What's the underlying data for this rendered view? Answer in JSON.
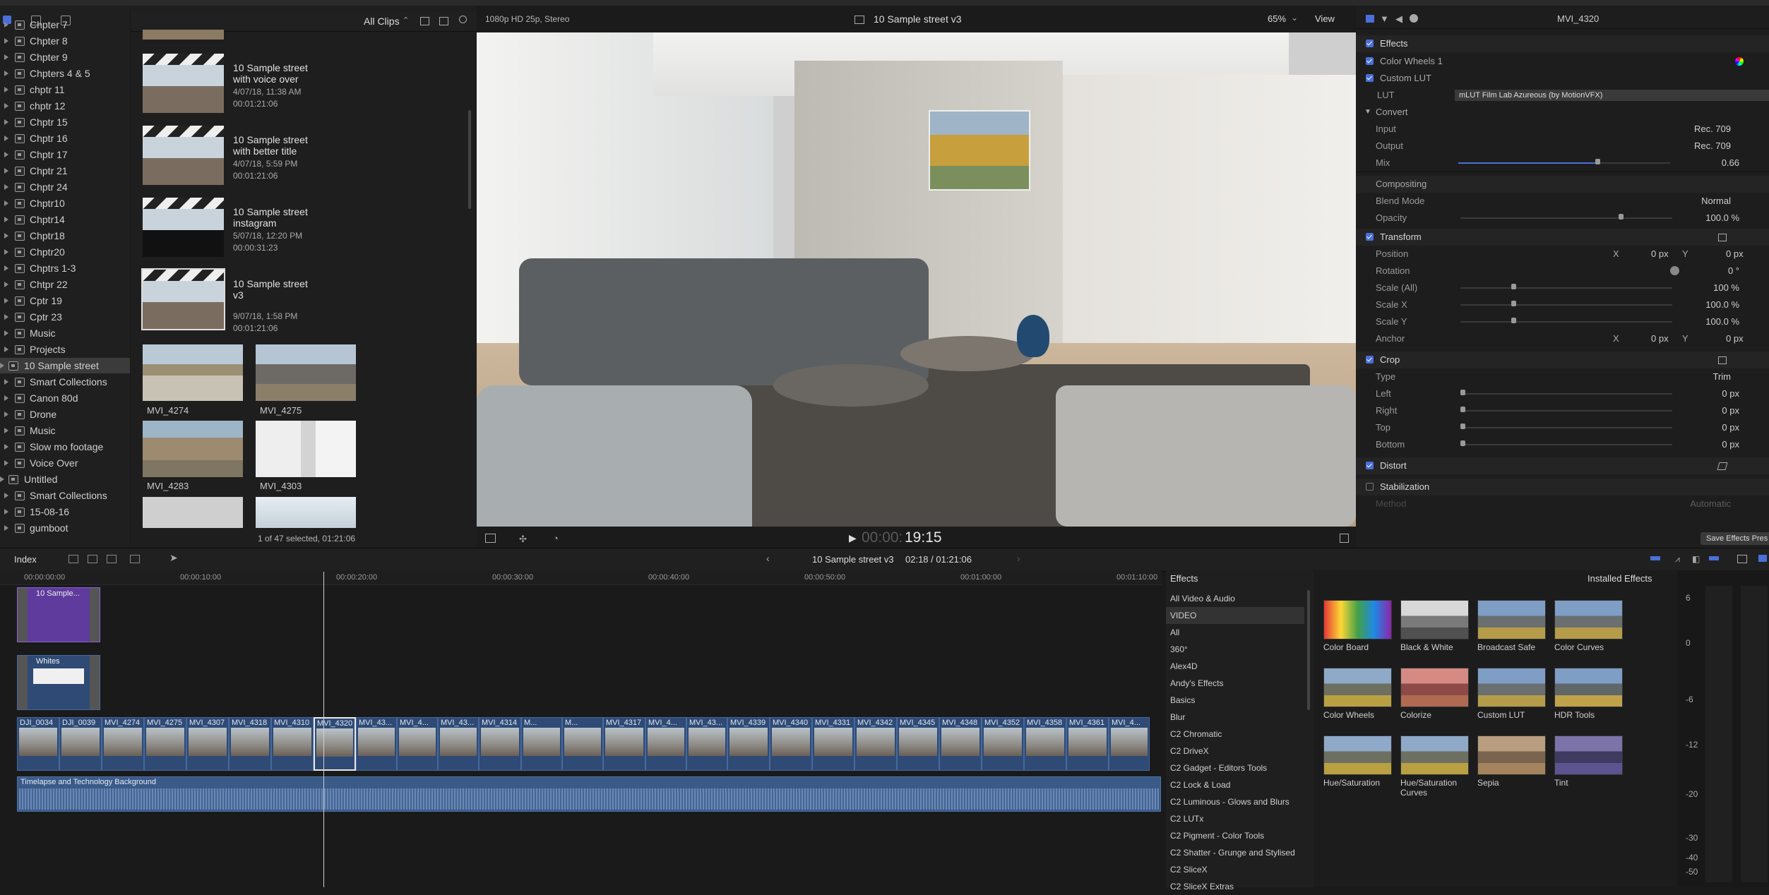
{
  "sidebar": {
    "items": [
      {
        "label": "Chpter 7",
        "lvl": 1
      },
      {
        "label": "Chpter 8",
        "lvl": 1
      },
      {
        "label": "Chpter 9",
        "lvl": 1
      },
      {
        "label": "Chpters 4 & 5",
        "lvl": 1
      },
      {
        "label": "chptr 11",
        "lvl": 1
      },
      {
        "label": "chptr 12",
        "lvl": 1
      },
      {
        "label": "Chptr 15",
        "lvl": 1
      },
      {
        "label": "Chptr 16",
        "lvl": 1
      },
      {
        "label": "Chptr 17",
        "lvl": 1
      },
      {
        "label": "Chptr 21",
        "lvl": 1
      },
      {
        "label": "Chptr 24",
        "lvl": 1
      },
      {
        "label": "Chptr10",
        "lvl": 1
      },
      {
        "label": "Chptr14",
        "lvl": 1
      },
      {
        "label": "Chptr18",
        "lvl": 1
      },
      {
        "label": "Chptr20",
        "lvl": 1
      },
      {
        "label": "Chptrs 1-3",
        "lvl": 1
      },
      {
        "label": "Chtpr 22",
        "lvl": 1
      },
      {
        "label": "Cptr 19",
        "lvl": 1
      },
      {
        "label": "Cptr 23",
        "lvl": 1
      },
      {
        "label": "Music",
        "lvl": 1
      },
      {
        "label": "Projects",
        "lvl": 1
      },
      {
        "label": "10 Sample street",
        "lvl": 0,
        "selected": true
      },
      {
        "label": "Smart Collections",
        "lvl": 1
      },
      {
        "label": "Canon 80d",
        "lvl": 1
      },
      {
        "label": "Drone",
        "lvl": 1
      },
      {
        "label": "Music",
        "lvl": 1
      },
      {
        "label": "Slow mo footage",
        "lvl": 1
      },
      {
        "label": "Voice Over",
        "lvl": 1
      },
      {
        "label": "Untitled",
        "lvl": 0
      },
      {
        "label": "Smart Collections",
        "lvl": 1
      },
      {
        "label": "15-08-16",
        "lvl": 1
      },
      {
        "label": "gumboot",
        "lvl": 1
      }
    ]
  },
  "browser": {
    "filter_label": "All Clips",
    "clips": [
      {
        "title": "10 Sample street with  voice over",
        "date": "4/07/18, 11:38 AM",
        "duration": "00:01:21:06"
      },
      {
        "title": "10 Sample street with better title",
        "date": "4/07/18, 5:59 PM",
        "duration": "00:01:21:06"
      },
      {
        "title": "10 Sample street instagram",
        "date": "5/07/18, 12:20 PM",
        "duration": "00:00:31:23"
      },
      {
        "title": "10 Sample street v3",
        "date": "9/07/18, 1:58 PM",
        "duration": "00:01:21:06"
      }
    ],
    "grid": [
      {
        "label": "MVI_4274"
      },
      {
        "label": "MVI_4275"
      },
      {
        "label": "MVI_4283"
      },
      {
        "label": "MVI_4303"
      }
    ],
    "status": "1 of 47 selected, 01:21:06"
  },
  "viewer": {
    "format": "1080p HD 25p, Stereo",
    "title": "10 Sample street v3",
    "zoom": "65%",
    "view_label": "View",
    "timecode_dim": "00:00:",
    "timecode": "19:15"
  },
  "inspector": {
    "clip_name": "MVI_4320",
    "effects_header": "Effects",
    "color_wheels": "Color Wheels 1",
    "custom_lut": "Custom LUT",
    "lut_label": "LUT",
    "lut_value": "mLUT Film Lab Azureous (by MotionVFX)",
    "convert": "Convert",
    "input_label": "Input",
    "input_value": "Rec. 709",
    "output_label": "Output",
    "output_value": "Rec. 709",
    "mix_label": "Mix",
    "mix_value": "0.66",
    "mix_level": 0.66,
    "compositing": "Compositing",
    "blend_label": "Blend Mode",
    "blend_value": "Normal",
    "opacity_label": "Opacity",
    "opacity_value": "100.0 %",
    "transform": "Transform",
    "position_label": "Position",
    "x_label": "X",
    "y_label": "Y",
    "pos_x": "0 px",
    "pos_y": "0 px",
    "rotation_label": "Rotation",
    "rotation_value": "0 °",
    "scale_all_label": "Scale (All)",
    "scale_all_value": "100 %",
    "scale_x_label": "Scale X",
    "scale_x_value": "100.0 %",
    "scale_y_label": "Scale Y",
    "scale_y_value": "100.0 %",
    "anchor_label": "Anchor",
    "anchor_x": "0 px",
    "anchor_y": "0 px",
    "crop": "Crop",
    "type_label": "Type",
    "type_value": "Trim",
    "left_label": "Left",
    "right_label": "Right",
    "top_label": "Top",
    "bottom_label": "Bottom",
    "crop_value": "0 px",
    "distort": "Distort",
    "stabilization": "Stabilization",
    "method_label": "Method",
    "method_value": "Automatic",
    "save_btn": "Save Effects Pres"
  },
  "timeline": {
    "index_label": "Index",
    "project": "10 Sample street v3",
    "position": "02:18 / 01:21:06",
    "ruler": [
      "00:00:00:00",
      "00:00:10:00",
      "00:00:20:00",
      "00:00:30:00",
      "00:00:40:00",
      "00:00:50:00",
      "00:01:00:00",
      "00:01:10:00"
    ],
    "title_clip": "10 Sample...",
    "whites_clip": "Whites",
    "audio_label": "Timelapse and Technology Background",
    "clips": [
      "DJI_0034",
      "DJI_0039",
      "MVI_4274",
      "MVI_4275",
      "MVI_4307",
      "MVI_4318",
      "MVI_4310",
      "MVI_4320",
      "MVI_43...",
      "MVI_4...",
      "MVI_43...",
      "MVI_4314",
      "M...",
      "M...",
      "MVI_4317",
      "MVI_4...",
      "MVI_43...",
      "MVI_4339",
      "MVI_4340",
      "MVI_4331",
      "MVI_4342",
      "MVI_4345",
      "MVI_4348",
      "MVI_4352",
      "MVI_4358",
      "MVI_4361",
      "MVI_4..."
    ]
  },
  "effects_browser": {
    "header": "Effects",
    "installed": "Installed Effects",
    "categories": [
      "All Video & Audio",
      "VIDEO",
      "All",
      "360°",
      "Alex4D",
      "Andy's Effects",
      "Basics",
      "Blur",
      "C2 Chromatic",
      "C2 DriveX",
      "C2 Gadget - Editors Tools",
      "C2 Lock & Load",
      "C2 Luminous - Glows and Blurs",
      "C2 LUTx",
      "C2 Pigment - Color Tools",
      "C2 Shatter - Grunge and Stylised",
      "C2 SliceX",
      "C2 SliceX Extras"
    ],
    "effects": [
      "Color Board",
      "Black & White",
      "Broadcast Safe",
      "Color Curves",
      "Color Wheels",
      "Colorize",
      "Custom LUT",
      "HDR Tools",
      "Hue/Saturation",
      "Hue/Saturation Curves",
      "Sepia",
      "Tint"
    ]
  },
  "meter": {
    "ticks": [
      "6",
      "0",
      "-6",
      "-12",
      "-20",
      "-30",
      "-40",
      "-50"
    ]
  }
}
